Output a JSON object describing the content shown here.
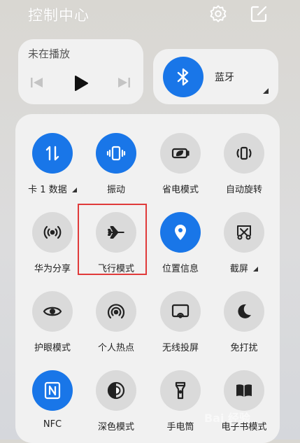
{
  "header": {
    "title": "控制中心",
    "settings_icon": "gear-icon",
    "edit_icon": "edit-icon"
  },
  "media": {
    "status": "未在播放",
    "controls": [
      "previous-track-icon",
      "play-icon",
      "next-track-icon"
    ]
  },
  "bluetooth": {
    "label": "蓝牙",
    "icon": "bluetooth-icon",
    "active": true
  },
  "colors": {
    "accent": "#1976e8",
    "tile_off": "#dadada",
    "card": "#f1f1f1",
    "highlight": "#e03a3a"
  },
  "tiles": [
    {
      "label": "卡 1 数据",
      "icon": "mobile-data-icon",
      "active": true,
      "has_menu": true
    },
    {
      "label": "振动",
      "icon": "vibrate-icon",
      "active": true,
      "has_menu": false
    },
    {
      "label": "省电模式",
      "icon": "battery-saver-icon",
      "active": false,
      "has_menu": false
    },
    {
      "label": "自动旋转",
      "icon": "auto-rotate-icon",
      "active": false,
      "has_menu": false
    },
    {
      "label": "华为分享",
      "icon": "huawei-share-icon",
      "active": false,
      "has_menu": false
    },
    {
      "label": "飞行模式",
      "icon": "airplane-icon",
      "active": false,
      "has_menu": false,
      "highlighted": true
    },
    {
      "label": "位置信息",
      "icon": "location-icon",
      "active": true,
      "has_menu": false
    },
    {
      "label": "截屏",
      "icon": "screenshot-icon",
      "active": false,
      "has_menu": true
    },
    {
      "label": "护眼模式",
      "icon": "eye-comfort-icon",
      "active": false,
      "has_menu": false
    },
    {
      "label": "个人热点",
      "icon": "hotspot-icon",
      "active": false,
      "has_menu": false
    },
    {
      "label": "无线投屏",
      "icon": "wireless-projection-icon",
      "active": false,
      "has_menu": false
    },
    {
      "label": "免打扰",
      "icon": "do-not-disturb-icon",
      "active": false,
      "has_menu": false
    },
    {
      "label": "NFC",
      "icon": "nfc-icon",
      "active": true,
      "has_menu": false
    },
    {
      "label": "深色模式",
      "icon": "dark-mode-icon",
      "active": false,
      "has_menu": false
    },
    {
      "label": "手电筒",
      "icon": "flashlight-icon",
      "active": false,
      "has_menu": false
    },
    {
      "label": "电子书模式",
      "icon": "ebook-icon",
      "active": false,
      "has_menu": false
    }
  ],
  "watermark": "Bai 经验"
}
